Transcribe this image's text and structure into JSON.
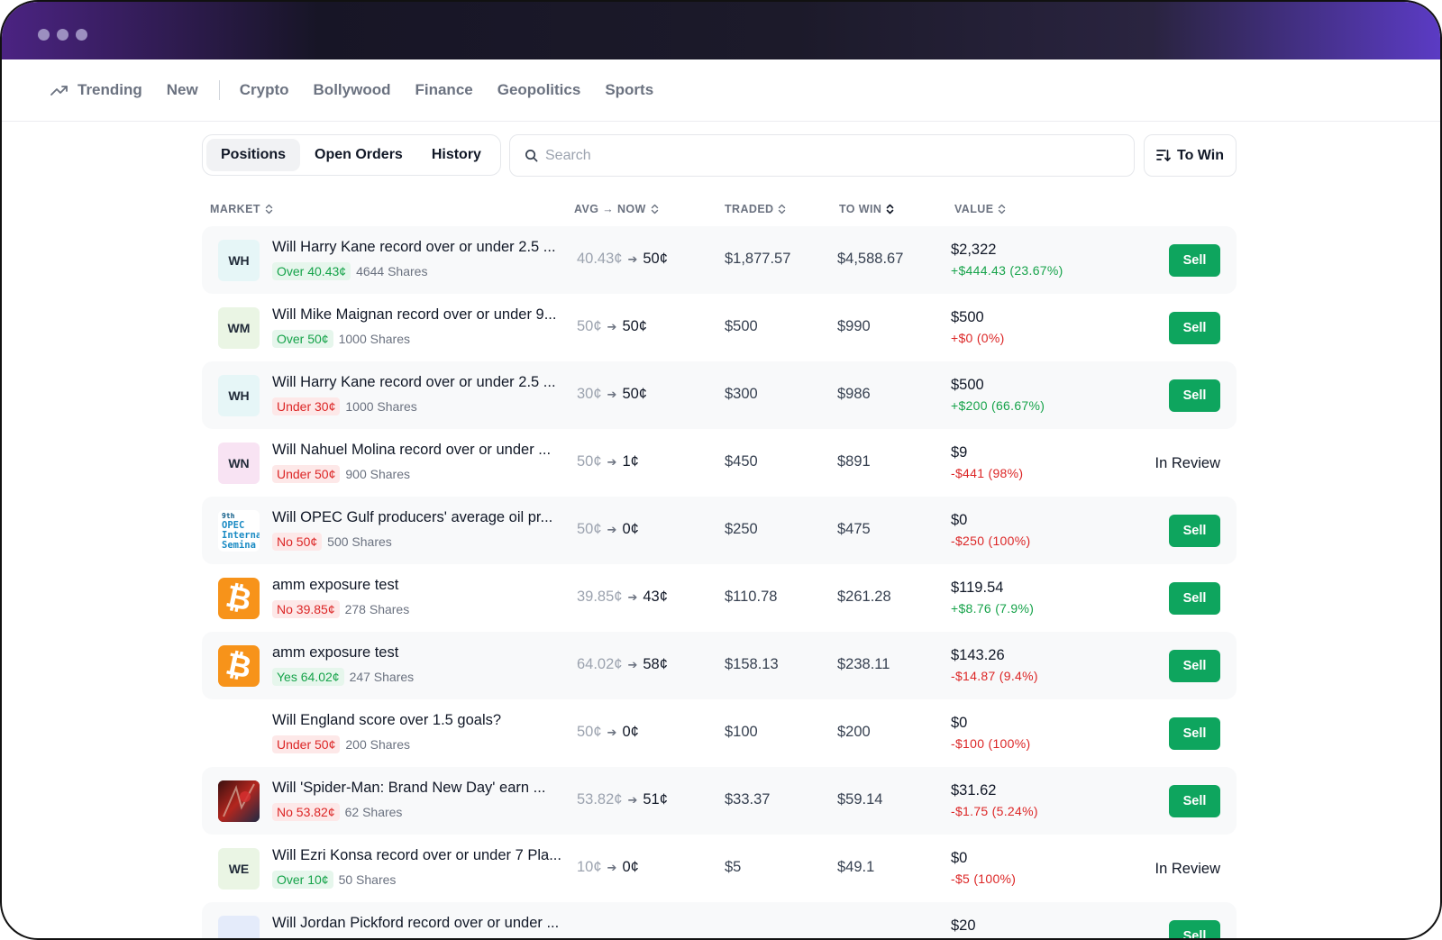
{
  "nav": {
    "categories": [
      {
        "label": "Trending",
        "icon": "trending-up-icon"
      },
      {
        "label": "New"
      },
      {
        "label": "Crypto"
      },
      {
        "label": "Bollywood"
      },
      {
        "label": "Finance"
      },
      {
        "label": "Geopolitics"
      },
      {
        "label": "Sports"
      }
    ]
  },
  "tabs": [
    {
      "label": "Positions",
      "active": true
    },
    {
      "label": "Open Orders",
      "active": false
    },
    {
      "label": "History",
      "active": false
    }
  ],
  "search": {
    "placeholder": "Search",
    "icon": "search-icon"
  },
  "sort": {
    "label": "To Win",
    "icon": "sort-icon"
  },
  "columns": {
    "market": "MARKET",
    "avg_now": "AVG → NOW",
    "traded": "TRADED",
    "to_win": "TO WIN",
    "value": "VALUE"
  },
  "actions": {
    "sell_label": "Sell",
    "in_review_label": "In Review"
  },
  "colors": {
    "accent_green": "#0ea55e",
    "positive": "#16a34a",
    "negative": "#dc2626"
  },
  "positions": [
    {
      "avatar_text": "WH",
      "avatar_type": "initials",
      "avatar_bg": "#e6f6f7",
      "title": "Will Harry Kane record over or under 2.5 ...",
      "outcome": "Over 40.43¢",
      "outcome_tone": "green",
      "shares": "4644 Shares",
      "avg": "40.43¢",
      "now": "50¢",
      "traded": "$1,877.57",
      "to_win": "$4,588.67",
      "value": "$2,322",
      "pnl": "+$444.43 (23.67%)",
      "pnl_tone": "pos",
      "status": "sell"
    },
    {
      "avatar_text": "WM",
      "avatar_type": "initials",
      "avatar_bg": "#eaf5e4",
      "title": "Will Mike Maignan record over or under 9...",
      "outcome": "Over 50¢",
      "outcome_tone": "green",
      "shares": "1000 Shares",
      "avg": "50¢",
      "now": "50¢",
      "traded": "$500",
      "to_win": "$990",
      "value": "$500",
      "pnl": "+$0 (0%)",
      "pnl_tone": "neg",
      "status": "sell"
    },
    {
      "avatar_text": "WH",
      "avatar_type": "initials",
      "avatar_bg": "#e6f6f7",
      "title": "Will Harry Kane record over or under 2.5 ...",
      "outcome": "Under 30¢",
      "outcome_tone": "red",
      "shares": "1000 Shares",
      "avg": "30¢",
      "now": "50¢",
      "traded": "$300",
      "to_win": "$986",
      "value": "$500",
      "pnl": "+$200 (66.67%)",
      "pnl_tone": "pos",
      "status": "sell"
    },
    {
      "avatar_text": "WN",
      "avatar_type": "initials",
      "avatar_bg": "#f8e3f3",
      "title": "Will Nahuel Molina record over or under ...",
      "outcome": "Under 50¢",
      "outcome_tone": "red",
      "shares": "900 Shares",
      "avg": "50¢",
      "now": "1¢",
      "traded": "$450",
      "to_win": "$891",
      "value": "$9",
      "pnl": "-$441 (98%)",
      "pnl_tone": "neg",
      "status": "review"
    },
    {
      "avatar_text": "9th OPEC Interna Semina",
      "avatar_type": "opec",
      "avatar_bg": "#ffffff",
      "title": "Will OPEC Gulf producers' average oil pr...",
      "outcome": "No 50¢",
      "outcome_tone": "red",
      "shares": "500 Shares",
      "avg": "50¢",
      "now": "0¢",
      "traded": "$250",
      "to_win": "$475",
      "value": "$0",
      "pnl": "-$250 (100%)",
      "pnl_tone": "neg",
      "status": "sell"
    },
    {
      "avatar_text": "",
      "avatar_type": "bitcoin",
      "avatar_bg": "#f7931a",
      "title": "amm exposure test",
      "outcome": "No 39.85¢",
      "outcome_tone": "red",
      "shares": "278 Shares",
      "avg": "39.85¢",
      "now": "43¢",
      "traded": "$110.78",
      "to_win": "$261.28",
      "value": "$119.54",
      "pnl": "+$8.76 (7.9%)",
      "pnl_tone": "pos",
      "status": "sell"
    },
    {
      "avatar_text": "",
      "avatar_type": "bitcoin",
      "avatar_bg": "#f7931a",
      "title": "amm exposure test",
      "outcome": "Yes 64.02¢",
      "outcome_tone": "green",
      "shares": "247 Shares",
      "avg": "64.02¢",
      "now": "58¢",
      "traded": "$158.13",
      "to_win": "$238.11",
      "value": "$143.26",
      "pnl": "-$14.87 (9.4%)",
      "pnl_tone": "neg",
      "status": "sell"
    },
    {
      "avatar_text": "",
      "avatar_type": "none",
      "avatar_bg": "transparent",
      "title": "Will England score over 1.5 goals?",
      "outcome": "Under 50¢",
      "outcome_tone": "red",
      "shares": "200 Shares",
      "avg": "50¢",
      "now": "0¢",
      "traded": "$100",
      "to_win": "$200",
      "value": "$0",
      "pnl": "-$100 (100%)",
      "pnl_tone": "neg",
      "status": "sell"
    },
    {
      "avatar_text": "",
      "avatar_type": "movie",
      "avatar_bg": "#7a1a1a",
      "title": "Will 'Spider-Man: Brand New Day' earn ...",
      "outcome": "No 53.82¢",
      "outcome_tone": "red",
      "shares": "62 Shares",
      "avg": "53.82¢",
      "now": "51¢",
      "traded": "$33.37",
      "to_win": "$59.14",
      "value": "$31.62",
      "pnl": "-$1.75 (5.24%)",
      "pnl_tone": "neg",
      "status": "sell"
    },
    {
      "avatar_text": "WE",
      "avatar_type": "initials",
      "avatar_bg": "#eaf5e4",
      "title": "Will Ezri Konsa record over or under 7 Pla...",
      "outcome": "Over 10¢",
      "outcome_tone": "green",
      "shares": "50 Shares",
      "avg": "10¢",
      "now": "0¢",
      "traded": "$5",
      "to_win": "$49.1",
      "value": "$0",
      "pnl": "-$5 (100%)",
      "pnl_tone": "neg",
      "status": "review"
    },
    {
      "avatar_text": "",
      "avatar_type": "initials",
      "avatar_bg": "#e4ebfa",
      "title": "Will Jordan Pickford record over or under ...",
      "outcome": "",
      "outcome_tone": "green",
      "shares": "",
      "avg": "",
      "now": "",
      "traded": "",
      "to_win": "",
      "value": "$20",
      "pnl": "",
      "pnl_tone": "pos",
      "status": "sell"
    }
  ]
}
